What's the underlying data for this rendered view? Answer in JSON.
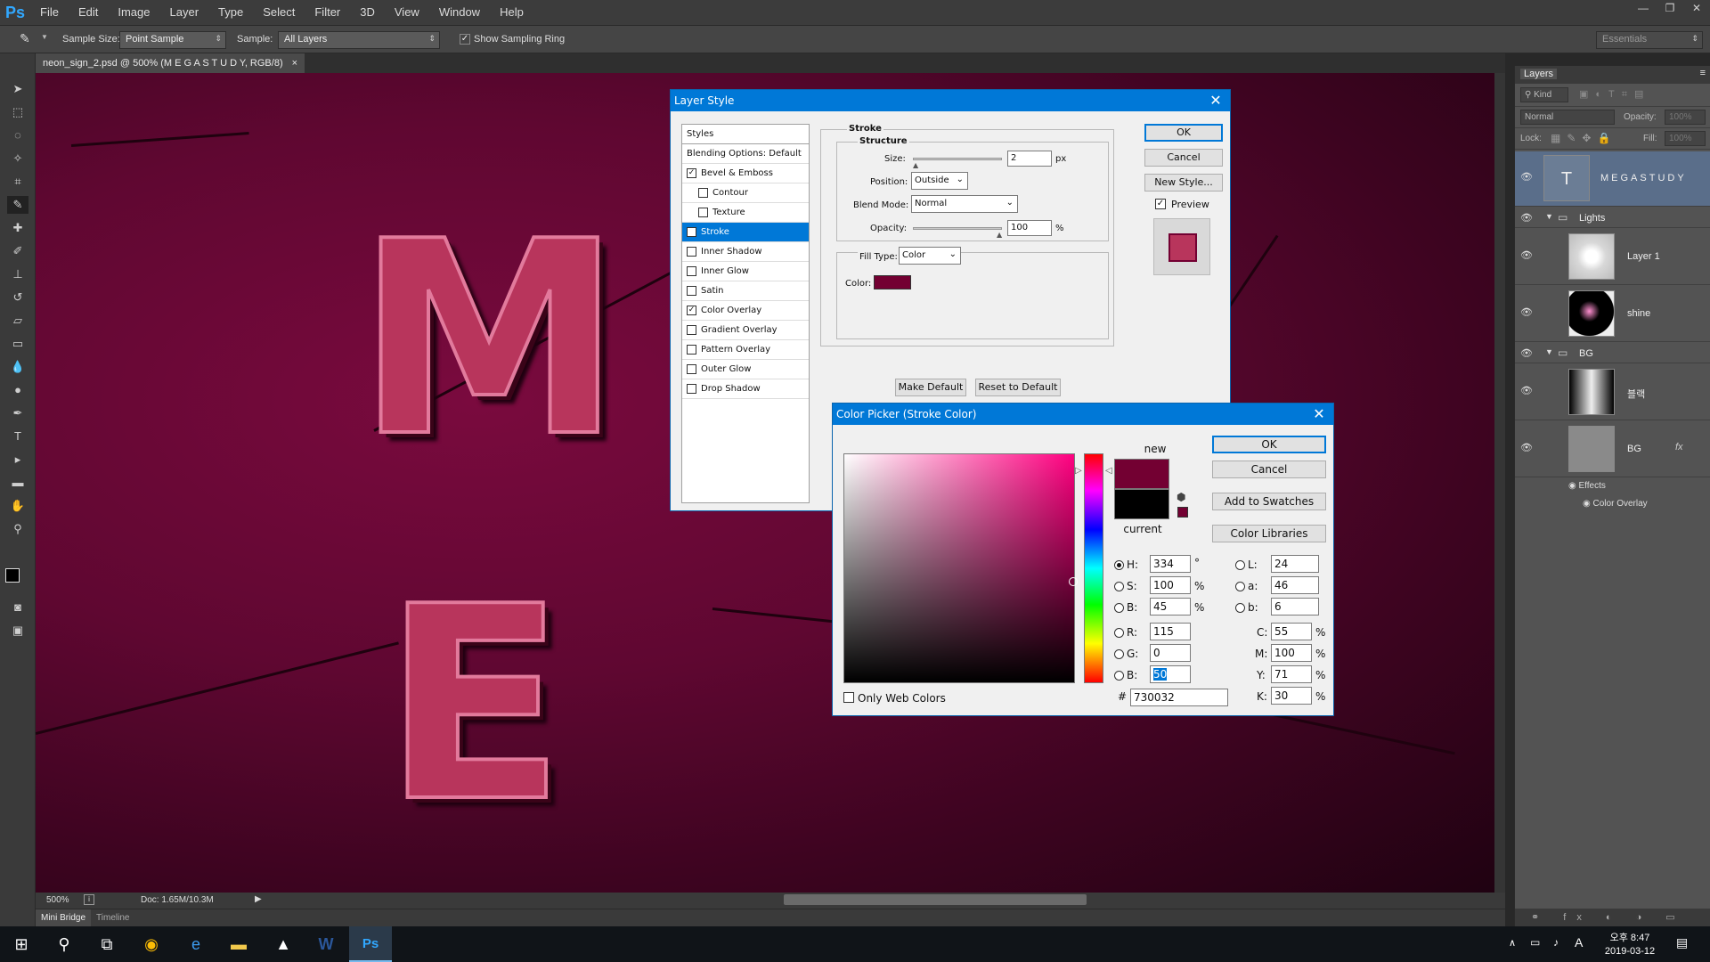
{
  "app": {
    "logo": "Ps",
    "menus": [
      "File",
      "Edit",
      "Image",
      "Layer",
      "Type",
      "Select",
      "Filter",
      "3D",
      "View",
      "Window",
      "Help"
    ],
    "win_minimize": "—",
    "win_restore": "❐",
    "win_close": "✕"
  },
  "options": {
    "sample_size_label": "Sample Size:",
    "sample_size_value": "Point Sample",
    "sample_label": "Sample:",
    "sample_value": "All Layers",
    "show_ring_label": "Show Sampling Ring",
    "workspace": "Essentials"
  },
  "document": {
    "tab_title": "neon_sign_2.psd @ 500% (M E G A S T U D Y, RGB/8)",
    "tab_close": "×",
    "letters": [
      "M",
      "E"
    ],
    "zoom": "500%",
    "doc_size": "Doc: 1.65M/10.3M",
    "bottom_tabs": [
      "Mini Bridge",
      "Timeline"
    ]
  },
  "layers_panel": {
    "tab": "Layers",
    "kind_filter": "Kind",
    "blend_mode": "Normal",
    "opacity_label": "Opacity:",
    "opacity_value": "100%",
    "lock_label": "Lock:",
    "fill_label": "Fill:",
    "fill_value": "100%",
    "layers": [
      {
        "name": "MEGASTUDY",
        "type": "text",
        "selected": true
      },
      {
        "name": "Lights",
        "type": "group"
      },
      {
        "name": "Layer 1",
        "type": "pixel"
      },
      {
        "name": "shine",
        "type": "pixel"
      },
      {
        "name": "BG",
        "type": "group"
      },
      {
        "name": "블랙",
        "type": "pixel"
      },
      {
        "name": "BG",
        "type": "pixel",
        "fx": "fx"
      }
    ],
    "effects_label": "Effects",
    "effect_item": "Color Overlay",
    "text_thumb_glyph": "T"
  },
  "layer_style": {
    "title": "Layer Style",
    "styles_header": "Styles",
    "blending_options": "Blending Options: Default",
    "items": [
      {
        "label": "Bevel & Emboss",
        "checked": true
      },
      {
        "label": "Contour",
        "checked": false
      },
      {
        "label": "Texture",
        "checked": false
      },
      {
        "label": "Stroke",
        "checked": true
      },
      {
        "label": "Inner Shadow",
        "checked": false
      },
      {
        "label": "Inner Glow",
        "checked": false
      },
      {
        "label": "Satin",
        "checked": false
      },
      {
        "label": "Color Overlay",
        "checked": true
      },
      {
        "label": "Gradient Overlay",
        "checked": false
      },
      {
        "label": "Pattern Overlay",
        "checked": false
      },
      {
        "label": "Outer Glow",
        "checked": false
      },
      {
        "label": "Drop Shadow",
        "checked": false
      }
    ],
    "section_title": "Stroke",
    "structure_title": "Structure",
    "size_label": "Size:",
    "size_value": "2",
    "size_unit": "px",
    "position_label": "Position:",
    "position_value": "Outside",
    "blend_label": "Blend Mode:",
    "blend_value": "Normal",
    "opacity_label": "Opacity:",
    "opacity_value": "100",
    "opacity_unit": "%",
    "fill_type_label": "Fill Type:",
    "fill_type_value": "Color",
    "color_label": "Color:",
    "stroke_color": "#730032",
    "make_default": "Make Default",
    "reset_default": "Reset to Default",
    "ok": "OK",
    "cancel": "Cancel",
    "new_style": "New Style...",
    "preview_label": "Preview",
    "preview_color": "#b8355c"
  },
  "color_picker": {
    "title": "Color Picker (Stroke Color)",
    "new_label": "new",
    "current_label": "current",
    "new_color": "#730032",
    "current_color": "#000000",
    "ok": "OK",
    "cancel": "Cancel",
    "add_swatches": "Add to Swatches",
    "color_libraries": "Color Libraries",
    "H": "334",
    "S": "100",
    "B": "45",
    "R": "115",
    "G": "0",
    "Bv": "50",
    "L": "24",
    "a": "46",
    "b": "6",
    "C": "55",
    "M": "100",
    "Y": "71",
    "K": "30",
    "hex": "730032",
    "deg": "°",
    "pct": "%",
    "web_colors": "Only Web Colors"
  },
  "taskbar": {
    "time": "오후 8:47",
    "date": "2019-03-12",
    "ime": "A"
  }
}
